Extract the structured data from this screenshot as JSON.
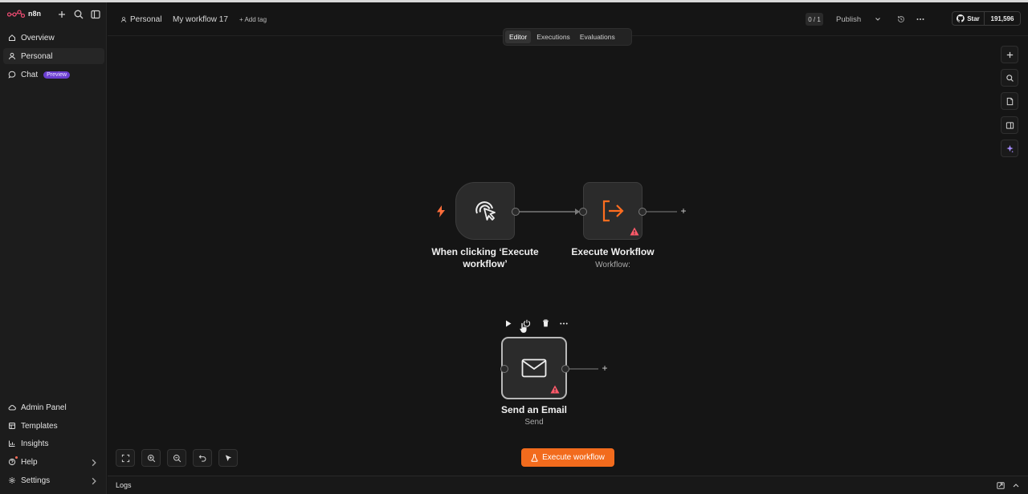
{
  "app": {
    "name": "n8n"
  },
  "sidebar": {
    "top_items": [
      {
        "label": "Overview",
        "icon": "home-icon"
      },
      {
        "label": "Personal",
        "icon": "user-icon"
      },
      {
        "label": "Chat",
        "icon": "chat-icon",
        "badge": "Preview"
      }
    ],
    "bottom_items": [
      {
        "label": "Admin Panel",
        "icon": "cloud-icon"
      },
      {
        "label": "Templates",
        "icon": "templates-icon"
      },
      {
        "label": "Insights",
        "icon": "insights-icon"
      },
      {
        "label": "Help",
        "icon": "help-icon"
      },
      {
        "label": "Settings",
        "icon": "gear-icon"
      }
    ]
  },
  "header": {
    "project": "Personal",
    "workflow_name": "My workflow 17",
    "add_tag": "+ Add tag",
    "version": "0 / 1",
    "publish_label": "Publish",
    "github_star": "Star",
    "github_count": "191,596"
  },
  "tabs": [
    "Editor",
    "Executions",
    "Evaluations"
  ],
  "nodes": {
    "trigger": {
      "title": "When clicking ‘Execute workflow’"
    },
    "execute_workflow": {
      "title": "Execute Workflow",
      "subtitle": "Workflow:"
    },
    "send_email": {
      "title": "Send an Email",
      "subtitle": "Send"
    }
  },
  "canvas": {
    "execute_button": "Execute workflow"
  },
  "logs": {
    "label": "Logs"
  },
  "colors": {
    "accent": "#f26b1d",
    "warning": "#ff5a6a",
    "badge": "#6b3fd0"
  }
}
